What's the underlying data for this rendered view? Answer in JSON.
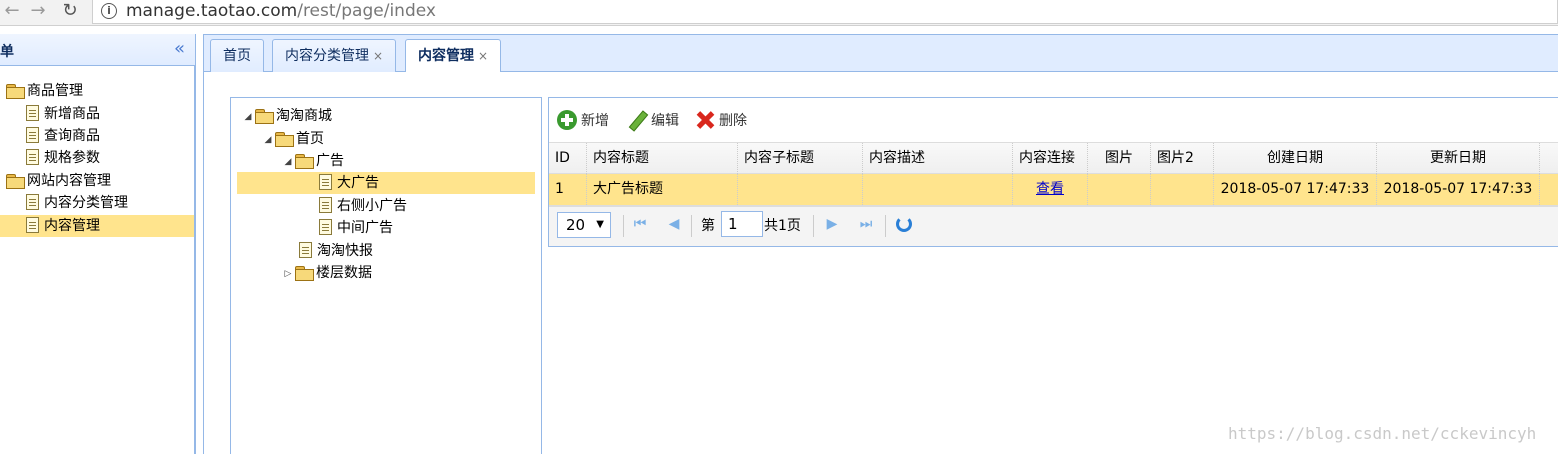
{
  "browser": {
    "url_host": "manage.taotao.com",
    "url_path": "/rest/page/index"
  },
  "left_menu": {
    "title": "单",
    "items": [
      {
        "label": "商品管理",
        "type": "folder"
      },
      {
        "label": "新增商品",
        "type": "file"
      },
      {
        "label": "查询商品",
        "type": "file"
      },
      {
        "label": "规格参数",
        "type": "file"
      },
      {
        "label": "网站内容管理",
        "type": "folder"
      },
      {
        "label": "内容分类管理",
        "type": "file"
      },
      {
        "label": "内容管理",
        "type": "file",
        "selected": true
      }
    ]
  },
  "tabs": [
    {
      "label": "首页",
      "closable": false
    },
    {
      "label": "内容分类管理",
      "closable": true
    },
    {
      "label": "内容管理",
      "closable": true,
      "active": true
    }
  ],
  "tab_close_glyph": "×",
  "content_tree": [
    {
      "label": "淘淘商城",
      "type": "folder",
      "expanded": true
    },
    {
      "label": "首页",
      "type": "folder",
      "expanded": true
    },
    {
      "label": "广告",
      "type": "folder",
      "expanded": true
    },
    {
      "label": "大广告",
      "type": "file",
      "selected": true
    },
    {
      "label": "右侧小广告",
      "type": "file"
    },
    {
      "label": "中间广告",
      "type": "file"
    },
    {
      "label": "淘淘快报",
      "type": "file"
    },
    {
      "label": "楼层数据",
      "type": "folder",
      "expanded": false
    }
  ],
  "toolbar": {
    "add_label": "新增",
    "edit_label": "编辑",
    "delete_label": "删除"
  },
  "grid": {
    "columns": [
      "ID",
      "内容标题",
      "内容子标题",
      "内容描述",
      "内容连接",
      "图片",
      "图片2",
      "创建日期",
      "更新日期"
    ],
    "rows": [
      {
        "id": "1",
        "title": "大广告标题",
        "subtitle": "",
        "desc": "",
        "link": "查看",
        "pic": "",
        "pic2": "",
        "created": "2018-05-07 17:47:33",
        "updated": "2018-05-07 17:47:33"
      }
    ],
    "selected_row_color": "#ffe48d"
  },
  "pager": {
    "page_size": "20",
    "page_prefix": "第",
    "current_page": "1",
    "total_text": "共1页"
  },
  "watermark": "https://blog.csdn.net/cckevincyh",
  "colors": {
    "border": "#95b8e7",
    "header_bg": "#e0ecff",
    "selection": "#ffe48d"
  }
}
